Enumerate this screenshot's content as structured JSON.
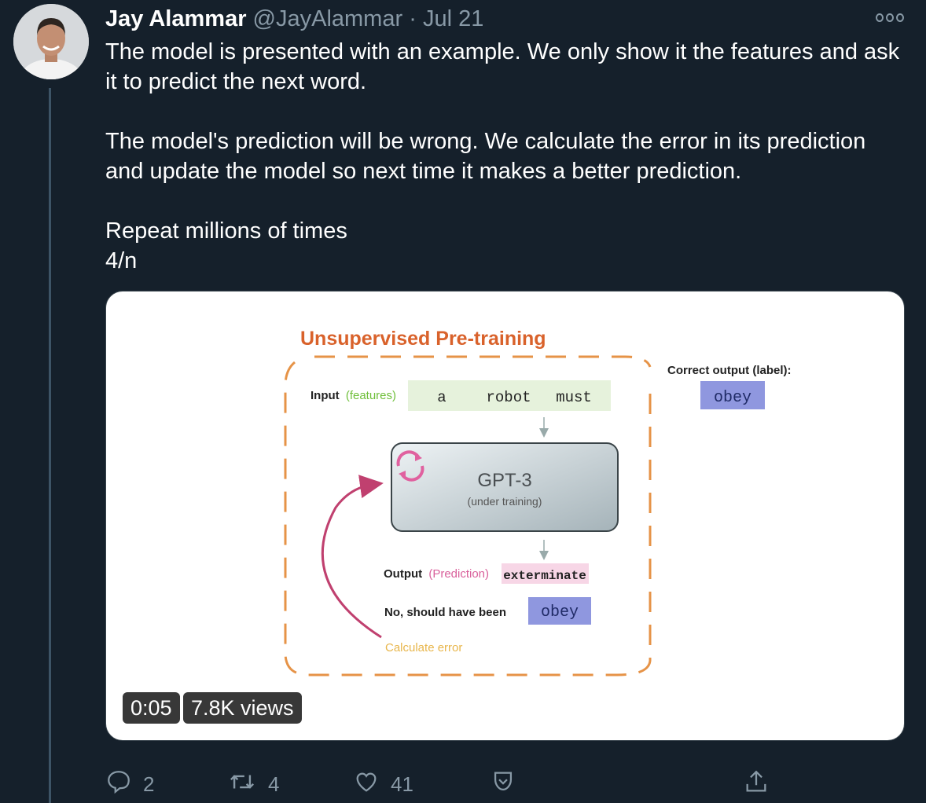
{
  "tweet": {
    "author_name": "Jay Alammar",
    "handle": "@JayAlammar",
    "separator": "·",
    "date": "Jul 21",
    "paragraphs": [
      "The model is presented with an example. We only show it the features and ask it to predict the next word.",
      "The model's prediction will be wrong. We calculate the error in its prediction and update the model so next time it makes a better prediction."
    ],
    "line_repeat": "Repeat millions of times",
    "line_count": "4/n"
  },
  "media": {
    "title": "Unsupervised Pre-training",
    "correct_output_label": "Correct output (label):",
    "label_word": "obey",
    "input_label": "Input",
    "features_label": "(features)",
    "input_tokens": [
      "a",
      "robot",
      "must"
    ],
    "model_name": "GPT-3",
    "model_sub": "(under training)",
    "output_label": "Output",
    "prediction_label": "(Prediction)",
    "prediction_word": "exterminate",
    "should_have_been": "No, should have been",
    "correct_word": "obey",
    "calculate_error": "Calculate error",
    "video_time": "0:05",
    "video_views": "7.8K views",
    "colors": {
      "title": "#d9622b",
      "features": "#6fbf3a",
      "prediction": "#d9609b",
      "error": "#e8b64c",
      "label_box": "#8f97df"
    }
  },
  "actions": {
    "reply_count": "2",
    "retweet_count": "4",
    "like_count": "41"
  },
  "icons": [
    "more-icon",
    "reply-icon",
    "retweet-icon",
    "like-icon",
    "bookmark-icon",
    "share-icon"
  ]
}
